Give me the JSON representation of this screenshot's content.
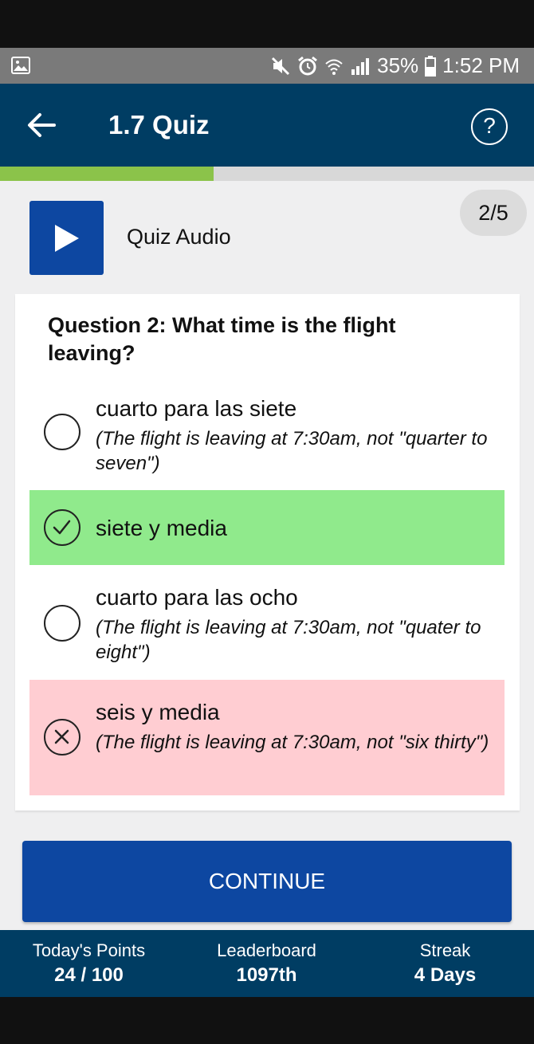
{
  "status_bar": {
    "battery": "35%",
    "time": "1:52 PM",
    "icons": [
      "gallery-icon",
      "mute-icon",
      "alarm-icon",
      "wifi-icon",
      "signal-icon",
      "battery-icon"
    ]
  },
  "header": {
    "title": "1.7 Quiz",
    "help_label": "?"
  },
  "progress": {
    "fraction": 0.4
  },
  "audio": {
    "label": "Quiz Audio"
  },
  "page_indicator": "2/5",
  "question": {
    "text": "Question 2: What time is the flight leaving?",
    "options": [
      {
        "label": "cuarto para las siete",
        "feedback": "(The flight is leaving at 7:30am, not \"quarter to seven\")",
        "state": "unselected"
      },
      {
        "label": "siete y media",
        "feedback": "",
        "state": "correct"
      },
      {
        "label": "cuarto para las ocho",
        "feedback": "(The flight is leaving at 7:30am, not \"quater to eight\")",
        "state": "unselected"
      },
      {
        "label": "seis y media",
        "feedback": "(The flight is leaving at 7:30am, not \"six thirty\")",
        "state": "wrong"
      }
    ]
  },
  "continue_label": "CONTINUE",
  "footer": {
    "points_label": "Today's Points",
    "points_value": "24 / 100",
    "leaderboard_label": "Leaderboard",
    "leaderboard_value": "1097th",
    "streak_label": "Streak",
    "streak_value": "4 Days"
  },
  "colors": {
    "header": "#003d63",
    "accent_blue": "#0d47a1",
    "progress": "#8bc34a",
    "correct": "#90ea8c",
    "wrong": "#ffcdd2"
  }
}
